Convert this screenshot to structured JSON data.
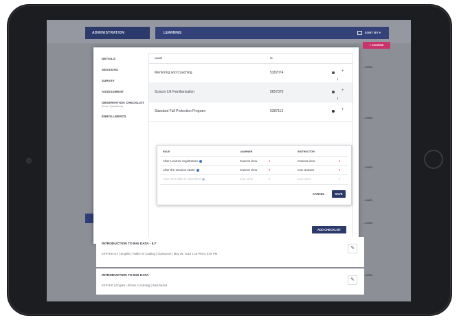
{
  "header": {
    "admin_tab": "ADMINISTRATION",
    "section": "LEARNING",
    "sort_label": "SORT BY",
    "new_course": "+ COURSE"
  },
  "background_status": [
    "...SHED",
    "...SHED",
    "...SHED",
    "...SHED",
    "...SHED",
    "...SHED"
  ],
  "modal": {
    "nav": [
      {
        "label": "DETAILS"
      },
      {
        "label": "SESSIONS"
      },
      {
        "label": "SURVEY"
      },
      {
        "label": "ASSESSMENT"
      },
      {
        "label": "OBSERVATION CHECKLIST",
        "sub": "(From Questions)"
      },
      {
        "label": "ENROLLMENTS"
      }
    ],
    "table": {
      "columns": [
        "NAME",
        "ID"
      ],
      "rows": [
        {
          "name": "Mentoring and Coaching",
          "id": "5387074"
        },
        {
          "name": "Scissor Lift Familiarization",
          "id": "5657376"
        },
        {
          "name": "Standard Fall Protection Program",
          "id": "5387113"
        }
      ]
    },
    "rules": {
      "columns": [
        "RULE",
        "LEARNER",
        "INSTRUCTOR"
      ],
      "rows": [
        {
          "rule": "After Learner registration",
          "learner": "Cannot view",
          "instructor": "Cannot view",
          "faded": false
        },
        {
          "rule": "After the session starts",
          "learner": "Cannot view",
          "instructor": "Can answer",
          "faded": false
        },
        {
          "rule": "After Checklist is submitted",
          "learner": "Can view",
          "instructor": "Can view",
          "faded": true
        }
      ],
      "cancel_label": "CANCEL",
      "save_label": "SAVE"
    },
    "add_checklist_label": "ADD CHECKLIST"
  },
  "courses": [
    {
      "title": "INTRODUCTION TO BIG DATA - ILT",
      "meta": "EXP-BIG-ILT  |  English  |  Hidden in Catalog  |  Classroom  |  May 29, 2018 1:15 PM to 6:00 PM"
    },
    {
      "title": "INTRODUCTION TO BIG DATA",
      "meta": "EXP-BIG  |  English  |  Shown in Catalog  |  Web-based"
    }
  ],
  "colors": {
    "accent": "#2c3a6b",
    "pink": "#c9356a",
    "bezel": "#1c1d20"
  }
}
